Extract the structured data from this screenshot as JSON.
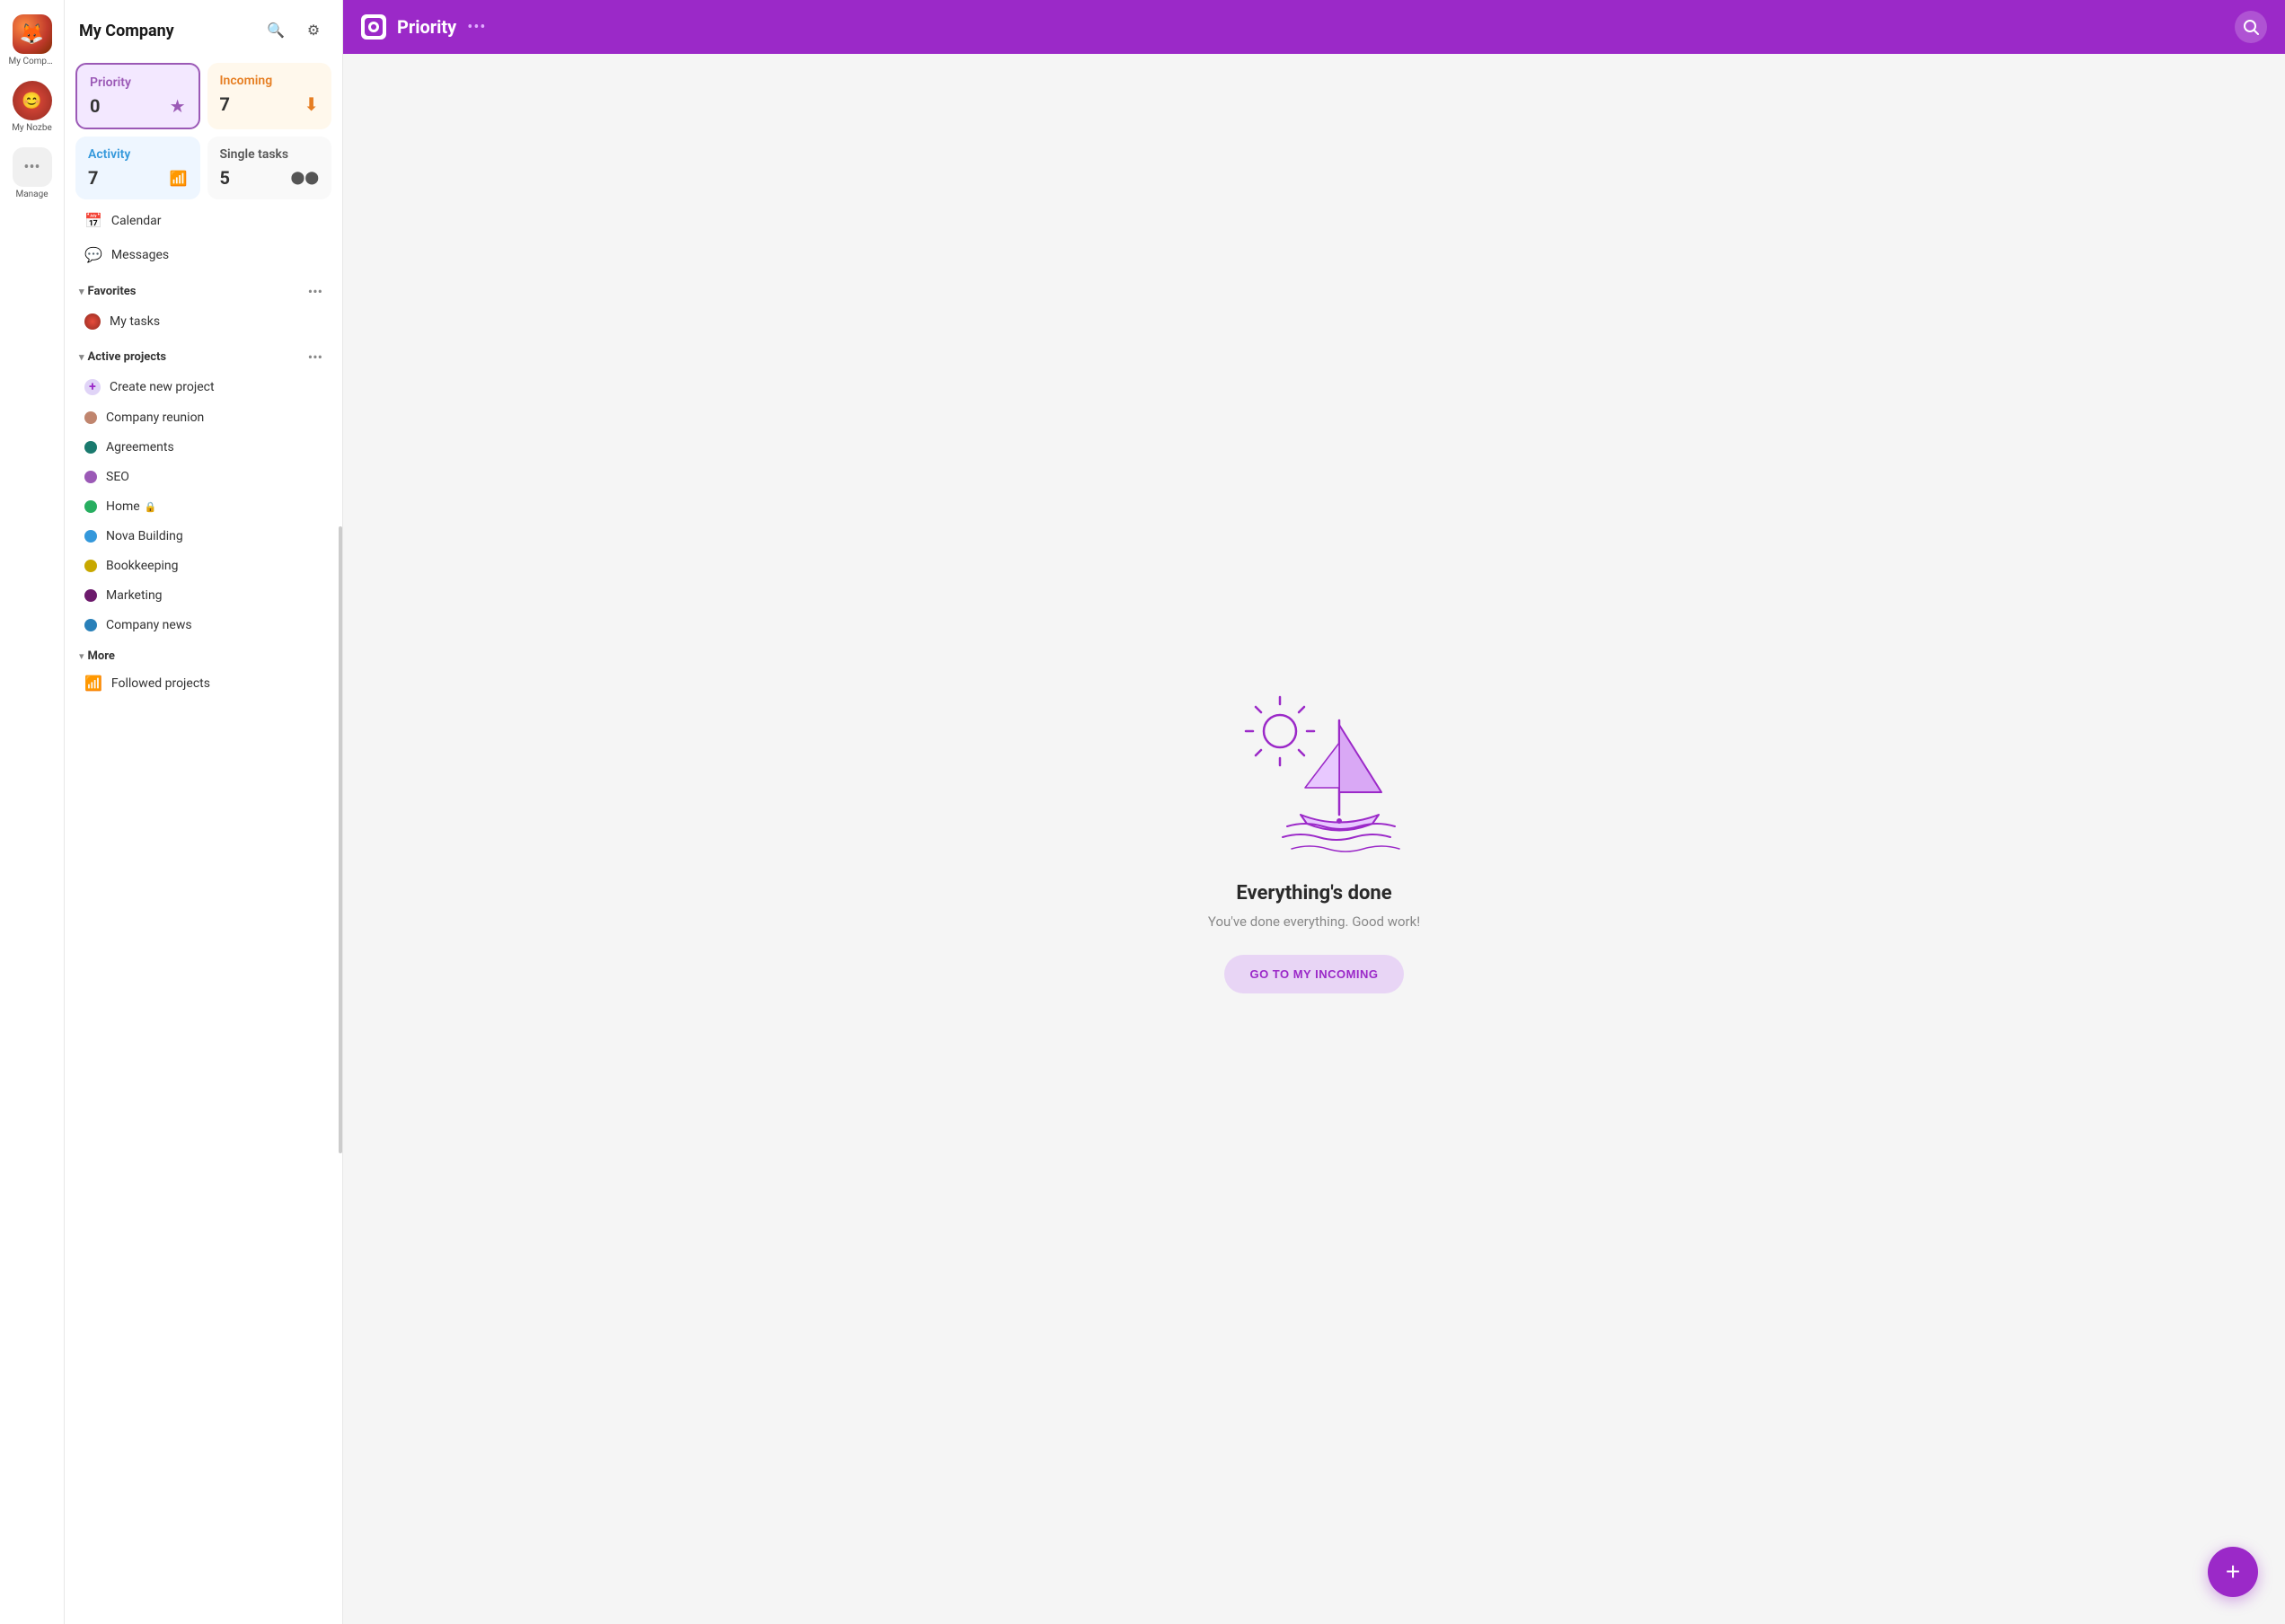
{
  "app": {
    "company_name": "My Company",
    "nozbe_label": "My Nozbe",
    "manage_label": "Manage"
  },
  "topbar": {
    "title": "Priority",
    "more_icon": "•••",
    "search_icon": "⊙"
  },
  "tiles": {
    "priority": {
      "name": "Priority",
      "count": "0",
      "icon": "★"
    },
    "incoming": {
      "name": "Incoming",
      "count": "7",
      "icon": "⬇"
    },
    "activity": {
      "name": "Activity",
      "count": "7",
      "icon": "📶"
    },
    "single": {
      "name": "Single tasks",
      "count": "5",
      "icon": "⬤⬤"
    }
  },
  "nav": {
    "calendar": "Calendar",
    "messages": "Messages"
  },
  "favorites": {
    "section_label": "Favorites",
    "items": [
      {
        "name": "My tasks",
        "avatar": true
      }
    ]
  },
  "active_projects": {
    "section_label": "Active projects",
    "create_label": "Create new project",
    "items": [
      {
        "name": "Company reunion",
        "color": "#c0856e"
      },
      {
        "name": "Agreements",
        "color": "#1a7a6e"
      },
      {
        "name": "SEO",
        "color": "#9b59b6"
      },
      {
        "name": "Home",
        "color": "#27ae60",
        "locked": true
      },
      {
        "name": "Nova Building",
        "color": "#3498db"
      },
      {
        "name": "Bookkeeping",
        "color": "#c8a800"
      },
      {
        "name": "Marketing",
        "color": "#6c1a6c"
      },
      {
        "name": "Company news",
        "color": "#2980b9"
      }
    ]
  },
  "more": {
    "section_label": "More",
    "followed": "Followed projects"
  },
  "empty_state": {
    "title": "Everything's done",
    "subtitle": "You've done everything. Good work!",
    "button_label": "GO TO MY INCOMING"
  },
  "fab": {
    "icon": "+"
  }
}
